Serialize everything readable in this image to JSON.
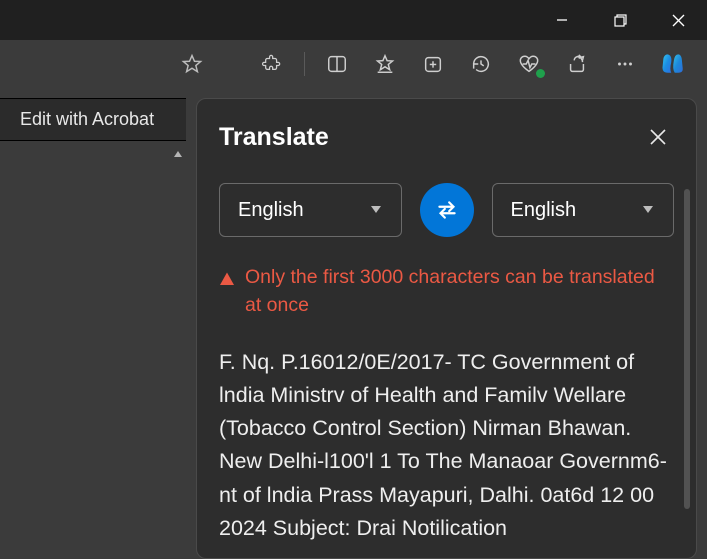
{
  "titlebar": {
    "minimize_glyph": "—",
    "maximize_glyph": "❐",
    "close_glyph": "✕"
  },
  "toolbar": {
    "favorite_icon": "favorite-star",
    "extensions_icon": "extensions",
    "split_icon": "split-screen",
    "favorites_list_icon": "favorites-list",
    "collections_icon": "collections",
    "history_icon": "history",
    "health_icon": "browser-health",
    "share_icon": "share",
    "more_icon": "more",
    "copilot_icon": "copilot"
  },
  "left": {
    "acrobat_label": "Edit with Acrobat",
    "scroll_glyph": "▴"
  },
  "panel": {
    "title": "Translate",
    "close_glyph": "✕",
    "source_lang": "English",
    "target_lang": "English",
    "swap_icon": "swap",
    "warn_text": "Only the first 3000 characters can be translated at once",
    "body_text": "F. Nq. P.16012/0E/2017- TC Government of lndia Ministrv of Health and Familv Wellare (Tobacco Control Section) Nirman Bhawan. New Delhi-l100'l 1 To The Manaoar Governm6-nt of lndia Prass Mayapuri, Dalhi. 0at6d 12 00 2024 Subject: Drai Notilication"
  }
}
